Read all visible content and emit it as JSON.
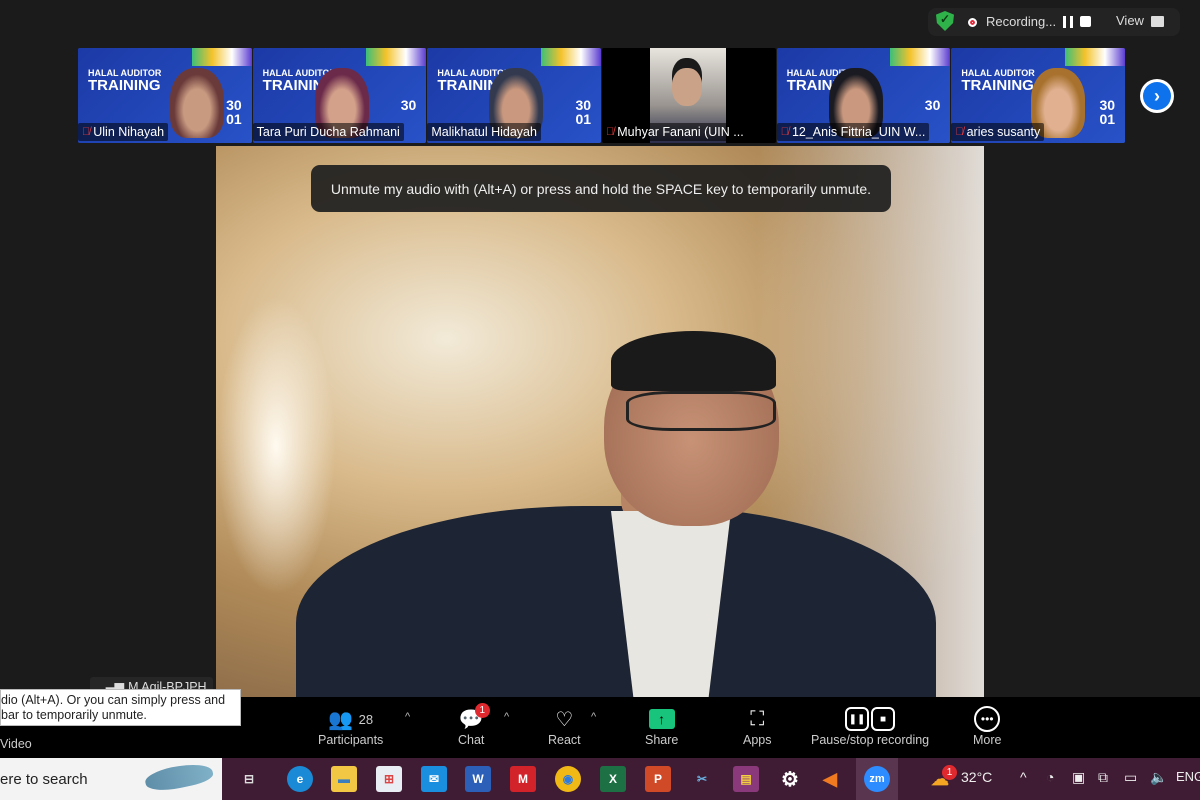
{
  "top_bar": {
    "recording_label": "Recording...",
    "view_label": "View",
    "colors": {
      "shield": "#2fb24a",
      "record": "#e0293a"
    }
  },
  "gallery": {
    "tiles": [
      {
        "name": "Ulin Nihayah",
        "muted": true,
        "banner": {
          "subtitle": "HALAL AUDITOR",
          "title": "TRAINING",
          "date_top": "30",
          "date_bottom": "01"
        }
      },
      {
        "name": "Tara Puri Ducha Rahmani",
        "muted": false,
        "banner": {
          "subtitle": "HALAL AUDITOR",
          "title": "TRAINING",
          "date_top": "30",
          "date_bottom": ""
        }
      },
      {
        "name": "Malikhatul Hidayah",
        "muted": false,
        "banner": {
          "subtitle": "HALAL AUDITOR",
          "title": "TRAINING",
          "date_top": "30",
          "date_bottom": "01"
        }
      },
      {
        "name": "Muhyar Fanani (UIN ...",
        "muted": true
      },
      {
        "name": "12_Anis Fittria_UIN W...",
        "muted": true,
        "banner": {
          "subtitle": "HALAL AUDITOR",
          "title": "TRAINING",
          "date_top": "30",
          "date_bottom": ""
        }
      },
      {
        "name": "aries susanty",
        "muted": true,
        "banner": {
          "subtitle": "HALAL AUDITOR",
          "title": "TRAINING",
          "date_top": "30",
          "date_bottom": "01"
        }
      }
    ],
    "next_icon": "chevron-right-icon"
  },
  "main_video": {
    "toast": "Unmute my audio with (Alt+A) or press and hold the SPACE key to temporarily unmute."
  },
  "self_view": {
    "name": "M Aqil-BPJPH"
  },
  "tooltip": {
    "line1": "dio (Alt+A). Or you can simply press and",
    "line2": " bar to temporarily unmute."
  },
  "toolbar": {
    "video_label": "Video",
    "participants_label": "Participants",
    "participants_count": "28",
    "chat_label": "Chat",
    "chat_badge": "1",
    "react_label": "React",
    "share_label": "Share",
    "apps_label": "Apps",
    "recording_label": "Pause/stop recording",
    "more_label": "More",
    "share_color": "#18c37b"
  },
  "taskbar": {
    "search_placeholder": "ere to search",
    "apps": [
      {
        "name": "task-view",
        "glyph": "⊟"
      },
      {
        "name": "edge",
        "glyph": "e"
      },
      {
        "name": "file-explorer",
        "glyph": "▬"
      },
      {
        "name": "store",
        "glyph": "⊞"
      },
      {
        "name": "mail",
        "glyph": "✉"
      },
      {
        "name": "word",
        "glyph": "W"
      },
      {
        "name": "mendeley",
        "glyph": "M"
      },
      {
        "name": "chrome",
        "glyph": "◉"
      },
      {
        "name": "excel",
        "glyph": "X"
      },
      {
        "name": "powerpoint",
        "glyph": "P"
      },
      {
        "name": "snipping-tool",
        "glyph": "✂"
      },
      {
        "name": "winrar",
        "glyph": "▤"
      },
      {
        "name": "settings",
        "glyph": "⚙"
      },
      {
        "name": "vlc",
        "glyph": "◀"
      },
      {
        "name": "zoom",
        "glyph": "zm"
      }
    ],
    "weather_badge": "1",
    "temperature": "32°C",
    "language": "ENG"
  }
}
